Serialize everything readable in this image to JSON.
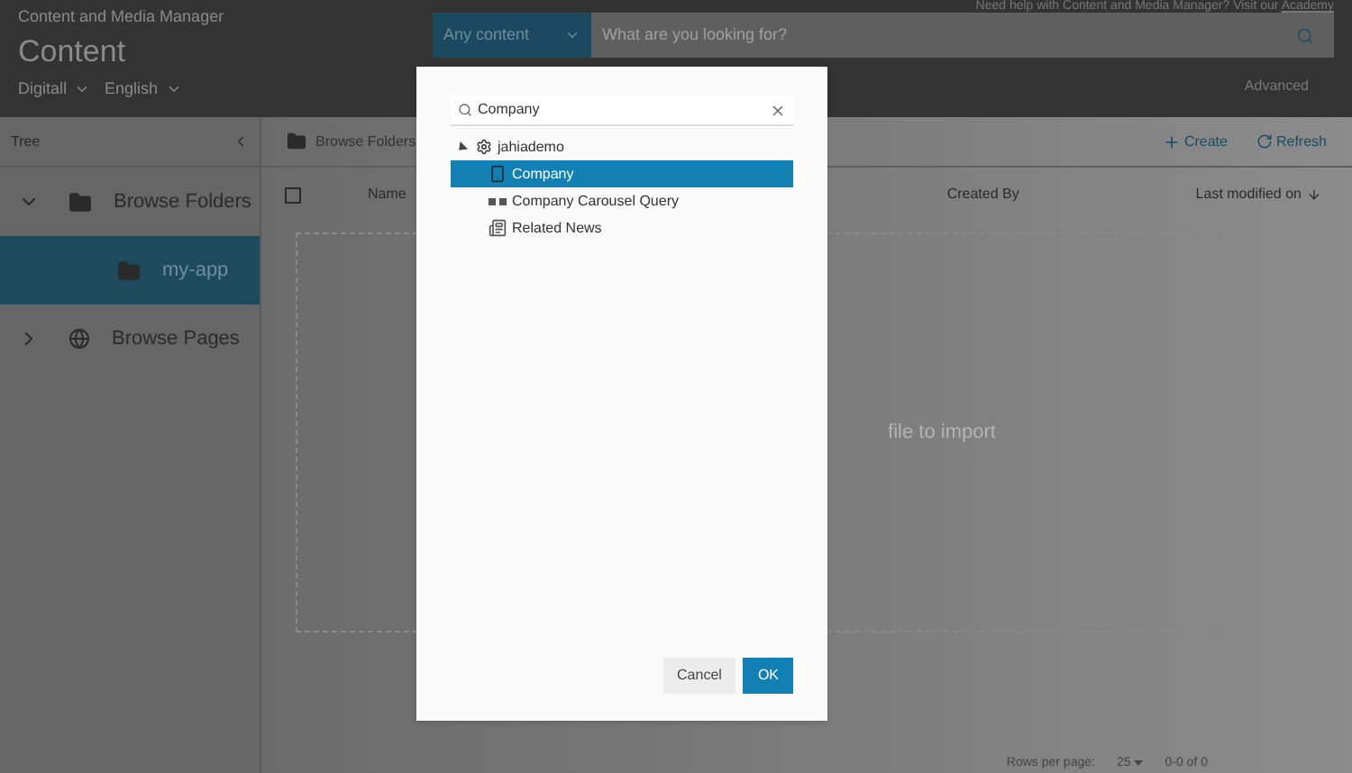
{
  "header": {
    "subtitle": "Content and Media Manager",
    "title": "Content",
    "site": "Digitall",
    "language": "English",
    "help_text": "Need help with Content and Media Manager? Visit our",
    "help_link": "Academy",
    "search": {
      "scope": "Any content",
      "placeholder": "What are you looking for?"
    },
    "advanced": "Advanced"
  },
  "tree_panel": {
    "title": "Tree",
    "items": [
      {
        "label": "Browse Folders",
        "kind": "folder",
        "expanded": true,
        "selected": false,
        "children": [
          {
            "label": "my-app",
            "kind": "folder",
            "selected": true
          }
        ]
      },
      {
        "label": "Browse Pages",
        "kind": "globe",
        "expanded": false,
        "selected": false
      }
    ]
  },
  "content": {
    "breadcrumb": "Browse Folders",
    "actions": [
      {
        "label": "Create",
        "kind": "create"
      },
      {
        "label": "Refresh",
        "kind": "refresh"
      }
    ],
    "select_all": {
      "checked": false
    },
    "columns": [
      "Name",
      "Created By",
      "Last modified on"
    ],
    "dropzone_text": "file to import",
    "pagination": {
      "rows_label": "Rows per page:",
      "rows_value": "25",
      "range": "0-0 of 0"
    }
  },
  "dialog": {
    "search": {
      "value": "Company"
    },
    "root": {
      "label": "jahiademo",
      "expanded": true,
      "children": [
        {
          "label": "Company",
          "kind": "page",
          "selected": true
        },
        {
          "label": "Company Carousel Query",
          "kind": "query",
          "selected": false
        },
        {
          "label": "Related News",
          "kind": "news",
          "selected": false
        }
      ]
    },
    "buttons": [
      {
        "label": "Cancel",
        "kind": "secondary"
      },
      {
        "label": "OK",
        "kind": "primary"
      }
    ]
  }
}
